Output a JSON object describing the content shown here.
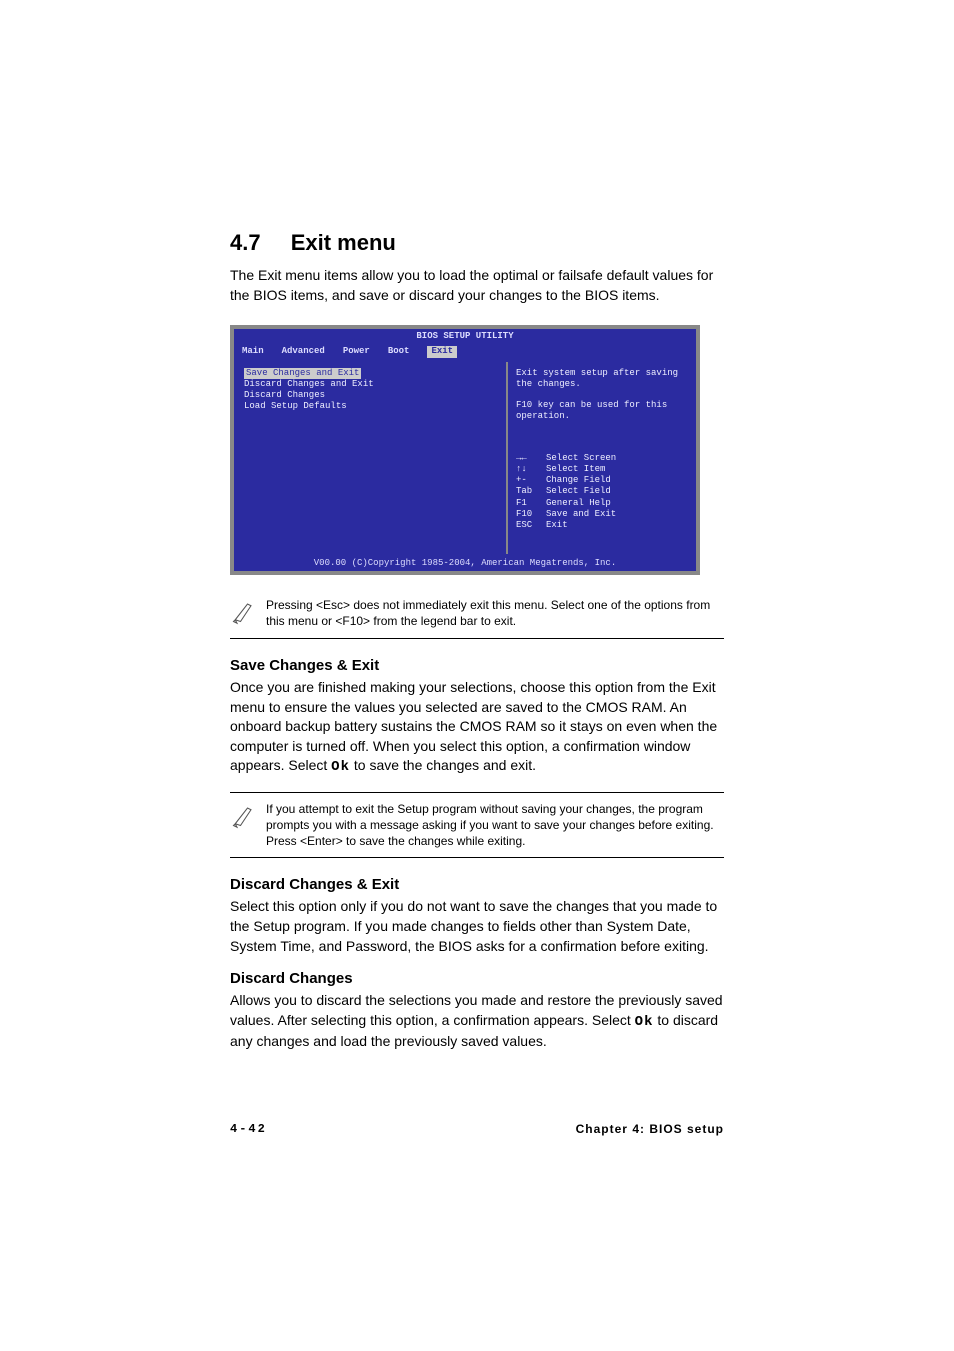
{
  "heading": {
    "number": "4.7",
    "title": "Exit menu"
  },
  "intro": "The Exit menu items allow you to load the optimal or failsafe default values for the BIOS items, and save or discard your changes to the BIOS items.",
  "bios": {
    "title": "BIOS SETUP UTILITY",
    "tabs": [
      "Main",
      "Advanced",
      "Power",
      "Boot",
      "Exit"
    ],
    "menu_items": [
      "Save Changes and Exit",
      "Discard Changes and Exit",
      "Discard Changes",
      "",
      "Load Setup Defaults"
    ],
    "desc1": "Exit system setup after saving the changes.",
    "desc2": "F10 key can be used for this operation.",
    "keys": [
      {
        "k": "→←",
        "v": "Select Screen"
      },
      {
        "k": "↑↓",
        "v": "Select Item"
      },
      {
        "k": "+-",
        "v": "Change Field"
      },
      {
        "k": "Tab",
        "v": "Select Field"
      },
      {
        "k": "F1",
        "v": "General Help"
      },
      {
        "k": "F10",
        "v": "Save and Exit"
      },
      {
        "k": "ESC",
        "v": "Exit"
      }
    ],
    "copyright": "V00.00 (C)Copyright 1985-2004, American Megatrends, Inc."
  },
  "note1": "Pressing <Esc> does not immediately exit this menu. Select one of the options from this menu or <F10> from the legend bar to exit.",
  "sections": {
    "s1": {
      "title": "Save Changes & Exit",
      "body_a": "Once you are finished making your selections, choose this option from the Exit menu to ensure the values you selected are saved to the CMOS RAM. An onboard backup battery sustains the CMOS RAM so it stays on even when the computer is turned off. When you select this option, a confirmation window appears. Select ",
      "body_ok": "Ok",
      "body_b": " to save the changes and exit."
    },
    "note2": " If you attempt to exit the Setup program without saving your changes, the program prompts you with a message asking if you want to save your changes before exiting. Press <Enter>  to save the  changes while exiting.",
    "s2": {
      "title": "Discard Changes & Exit",
      "body": "Select this option only if you do not want to save the changes that you made to the Setup program. If you made changes to fields other than System Date, System Time, and Password, the BIOS asks for a confirmation before exiting."
    },
    "s3": {
      "title": "Discard Changes",
      "body_a": "Allows you to discard the selections you made and restore the previously saved values. After selecting this option, a confirmation appears. Select ",
      "body_ok": "Ok",
      "body_b": " to discard any changes and load the previously saved values."
    }
  },
  "footer": {
    "page": "4-42",
    "chapter": "Chapter 4: BIOS setup"
  }
}
